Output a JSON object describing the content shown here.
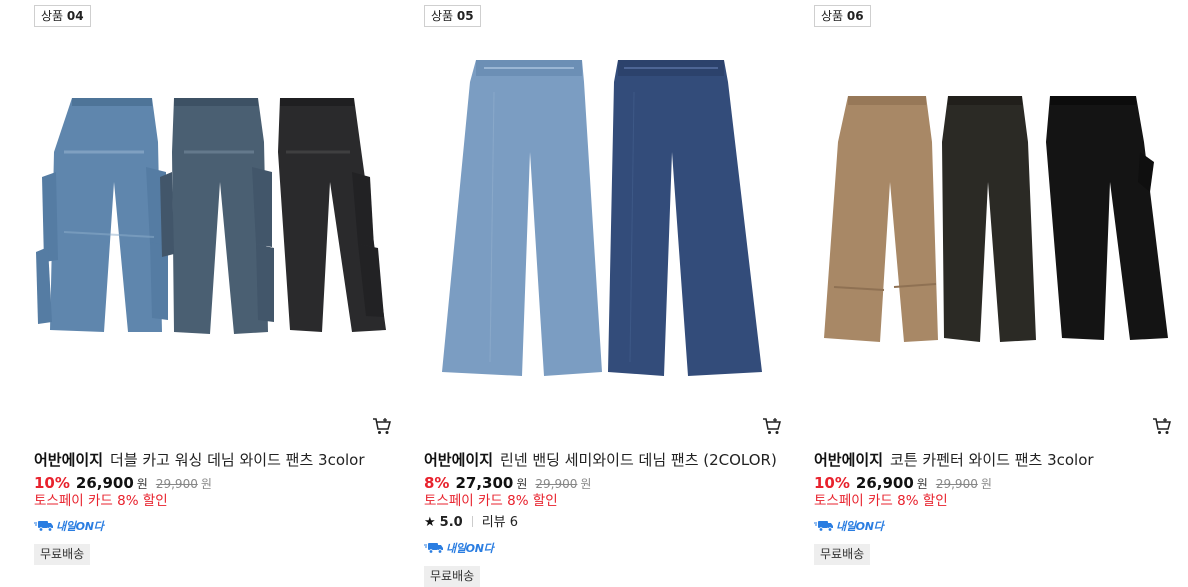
{
  "products": [
    {
      "tag_prefix": "상품",
      "tag_number": "04",
      "brand": "어반에이지",
      "name": "더블 카고 워싱 데님 와이드 팬츠 3color",
      "discount": "10%",
      "price": "26,900",
      "currency": "원",
      "original_price": "29,900",
      "promo": "토스페이 카드 8% 할인",
      "badge_next_day": "내일ON다",
      "shipping": "무료배송",
      "image_icon": "cargo-denim-pants-3color-image",
      "colors": [
        "#5f86ad",
        "#4a5f72",
        "#2a2a2c"
      ]
    },
    {
      "tag_prefix": "상품",
      "tag_number": "05",
      "brand": "어반에이지",
      "name": "린넨 밴딩 세미와이드 데님 팬츠 (2COLOR)",
      "discount": "8%",
      "price": "27,300",
      "currency": "원",
      "original_price": "29,900",
      "promo": "토스페이 카드 8% 할인",
      "rating": "5.0",
      "review_label": "리뷰 6",
      "badge_next_day": "내일ON다",
      "shipping": "무료배송",
      "image_icon": "linen-denim-pants-2color-image",
      "colors": [
        "#7b9dc2",
        "#334c7a"
      ]
    },
    {
      "tag_prefix": "상품",
      "tag_number": "06",
      "brand": "어반에이지",
      "name": "코튼 카펜터 와이드 팬츠 3color",
      "discount": "10%",
      "price": "26,900",
      "currency": "원",
      "original_price": "29,900",
      "promo": "토스페이 카드 8% 할인",
      "badge_next_day": "내일ON다",
      "shipping": "무료배송",
      "image_icon": "carpenter-pants-3color-image",
      "colors": [
        "#a88866",
        "#2b2a25",
        "#141414"
      ]
    }
  ],
  "theme": {
    "discount_color": "#e8222d",
    "badge_color": "#2a7de1"
  }
}
